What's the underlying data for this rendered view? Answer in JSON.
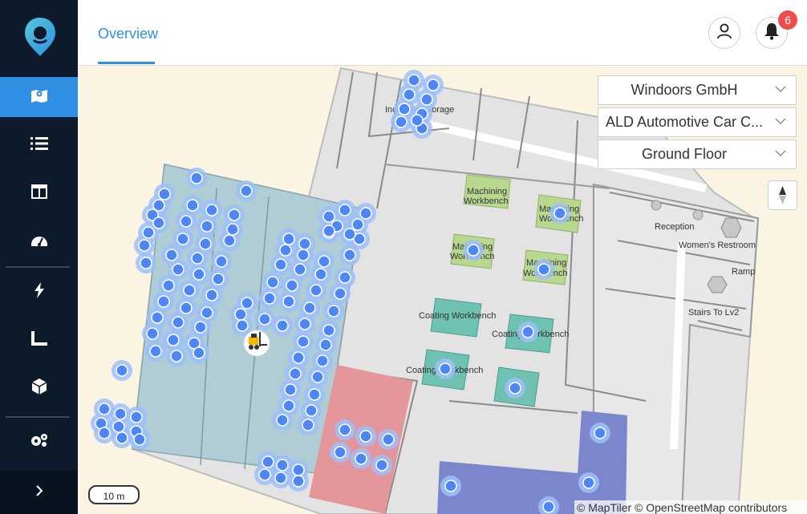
{
  "sidebar": {
    "logo": "map-pin-logo-icon",
    "items": [
      {
        "name": "map",
        "icon": "map-icon",
        "active": true
      },
      {
        "name": "list",
        "icon": "list-icon",
        "active": false
      },
      {
        "name": "layout",
        "icon": "layout-icon",
        "active": false
      },
      {
        "name": "dashboard",
        "icon": "gauge-icon",
        "active": false
      },
      {
        "name": "energy",
        "icon": "lightning-icon",
        "active": false
      },
      {
        "name": "measure",
        "icon": "ruler-icon",
        "active": false
      },
      {
        "name": "assets",
        "icon": "cube-icon",
        "active": false
      },
      {
        "name": "settings",
        "icon": "gears-icon",
        "active": false
      }
    ],
    "expand_glyph": ">"
  },
  "header": {
    "tab_label": "Overview",
    "notification_count": "6"
  },
  "selectors": {
    "company": "Windoors GmbH",
    "site": "ALD Automotive Car C...",
    "floor": "Ground Floor"
  },
  "map": {
    "labels": {
      "incoming_storage": "Incoming Storage",
      "machining_1": "Machining",
      "machining_1b": "Workbench",
      "machining_2": "Machining",
      "machining_2b": "Workbench",
      "machining_3": "Machining",
      "machining_3b": "Workbench",
      "machining_4": "Machining",
      "machining_4b": "Workbench",
      "coating_1": "Coating Workbench",
      "coating_2": "Coating Workbench",
      "coating_3": "Coating Workbench",
      "reception": "Reception",
      "womens_restroom": "Women's Restroom",
      "ramp": "Ramp",
      "stairs": "Stairs To Lv2"
    },
    "scale": "10 m",
    "attribution": "© MapTiler © OpenStreetMap contributors",
    "colors": {
      "storage_zone": "#b0ccd4",
      "red_zone": "#e4969a",
      "purple_zone": "#7c86cc",
      "machining": "#b8d88f",
      "coating": "#6fc1b2",
      "tag_marker": "#4f86f5"
    }
  }
}
